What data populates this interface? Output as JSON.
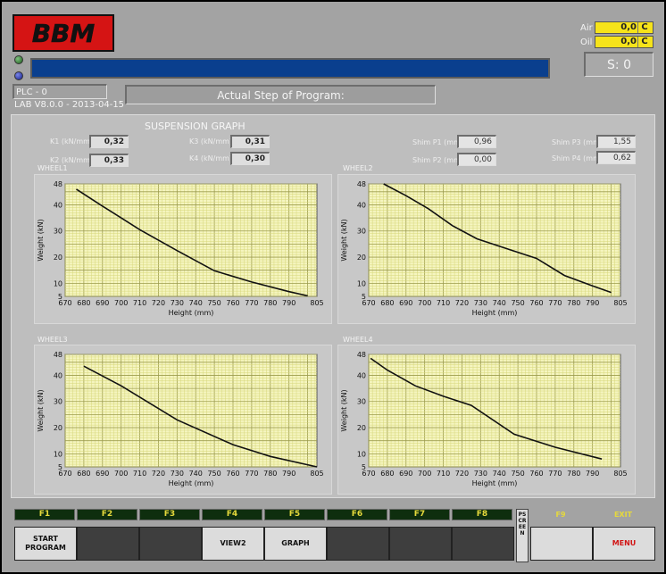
{
  "header": {
    "logo_text": "BBM",
    "plc_label": "PLC - 0",
    "lab_version": "LAB V8.0.0 - 2013-04-15",
    "step_label": "Actual Step of Program:",
    "air_label": "Air",
    "oil_label": "Oil",
    "air_value": "0,0",
    "oil_value": "0,0",
    "temp_unit": "C",
    "s_counter": "S: 0"
  },
  "panel": {
    "title": "SUSPENSION GRAPH",
    "params": [
      {
        "label": "K1 (kN/mm)",
        "value": "0,32"
      },
      {
        "label": "K2 (kN/mm)",
        "value": "0,33"
      },
      {
        "label": "K3 (kN/mm)",
        "value": "0,31"
      },
      {
        "label": "K4 (kN/mm)",
        "value": "0,30"
      }
    ],
    "shims": [
      {
        "label": "Shim P1 (mm)",
        "value": "0,96"
      },
      {
        "label": "Shim P2 (mm)",
        "value": "0,00"
      },
      {
        "label": "Shim P3 (mm)",
        "value": "1,55"
      },
      {
        "label": "Shim P4 (mm)",
        "value": "0,62"
      }
    ]
  },
  "colors": {
    "plot_background": "#f5f5c0",
    "grid_minor": "#d7d77a",
    "curve": "#111111",
    "function_key_text": "#e6d93c",
    "menu_text": "#d11515"
  },
  "chart_data": [
    {
      "type": "line",
      "title": "WHEEL1",
      "xlabel": "Height (mm)",
      "ylabel": "Weight (kN)",
      "xlim": [
        670,
        805
      ],
      "ylim": [
        5,
        48
      ],
      "xticks": [
        670,
        680,
        690,
        700,
        710,
        720,
        730,
        740,
        750,
        760,
        770,
        780,
        790,
        805
      ],
      "yticks": [
        5,
        10,
        20,
        30,
        40,
        48
      ],
      "grid": true,
      "x": [
        676,
        690,
        710,
        730,
        750,
        770,
        790,
        800
      ],
      "y": [
        46,
        39.5,
        30.5,
        22.5,
        14.8,
        10.5,
        6.8,
        5.2
      ]
    },
    {
      "type": "line",
      "title": "WHEEL2",
      "xlabel": "Height (mm)",
      "ylabel": "Weight (kN)",
      "xlim": [
        670,
        805
      ],
      "ylim": [
        5,
        48
      ],
      "xticks": [
        670,
        680,
        690,
        700,
        710,
        720,
        730,
        740,
        750,
        760,
        770,
        780,
        790,
        805
      ],
      "yticks": [
        5,
        10,
        20,
        30,
        40,
        48
      ],
      "grid": true,
      "x": [
        678,
        690,
        702,
        715,
        728,
        745,
        760,
        775,
        790,
        800
      ],
      "y": [
        48,
        43.5,
        38.5,
        32,
        27,
        23,
        19.5,
        13,
        9,
        6.5
      ]
    },
    {
      "type": "line",
      "title": "WHEEL3",
      "xlabel": "Height (mm)",
      "ylabel": "Weight (kN)",
      "xlim": [
        670,
        805
      ],
      "ylim": [
        5,
        48
      ],
      "xticks": [
        670,
        680,
        690,
        700,
        710,
        720,
        730,
        740,
        750,
        760,
        770,
        780,
        790,
        805
      ],
      "yticks": [
        5,
        10,
        20,
        30,
        40,
        48
      ],
      "grid": true,
      "x": [
        680,
        700,
        730,
        760,
        780,
        805
      ],
      "y": [
        43.5,
        36,
        23,
        13.5,
        9,
        5
      ]
    },
    {
      "type": "line",
      "title": "WHEEL4",
      "xlabel": "Height (mm)",
      "ylabel": "Weight (kN)",
      "xlim": [
        670,
        805
      ],
      "ylim": [
        5,
        48
      ],
      "xticks": [
        670,
        680,
        690,
        700,
        710,
        720,
        730,
        740,
        750,
        760,
        770,
        780,
        790,
        805
      ],
      "yticks": [
        5,
        10,
        20,
        30,
        40,
        48
      ],
      "grid": true,
      "x": [
        671,
        680,
        695,
        710,
        725,
        748,
        770,
        795
      ],
      "y": [
        46.5,
        42,
        36,
        32,
        28.5,
        17.5,
        12.5,
        8
      ]
    }
  ],
  "function_keys": [
    {
      "key": "F1",
      "label": "START PROGRAM",
      "lit": true
    },
    {
      "key": "F2",
      "label": "",
      "lit": false
    },
    {
      "key": "F3",
      "label": "",
      "lit": false
    },
    {
      "key": "F4",
      "label": "VIEW2",
      "lit": true
    },
    {
      "key": "F5",
      "label": "GRAPH",
      "lit": true
    },
    {
      "key": "F6",
      "label": "",
      "lit": false
    },
    {
      "key": "F7",
      "label": "",
      "lit": false
    },
    {
      "key": "F8",
      "label": "",
      "lit": false
    }
  ],
  "pscreen_label": "PSCREEN",
  "f9": {
    "key": "F9",
    "label": ""
  },
  "exit": {
    "key": "EXIT",
    "label": "MENU"
  }
}
